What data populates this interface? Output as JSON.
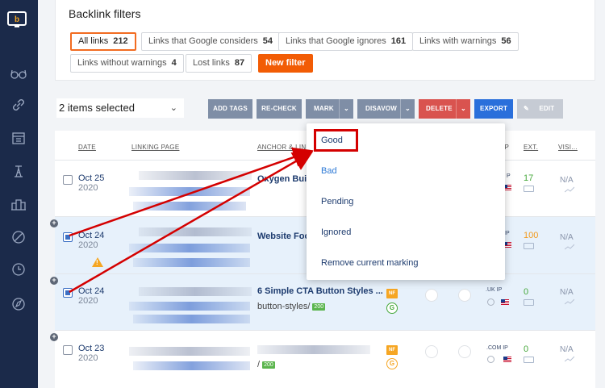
{
  "filters": {
    "title": "Backlink filters",
    "chips": [
      {
        "label": "All links",
        "count": "212"
      },
      {
        "label": "Links that Google considers",
        "count": "54"
      },
      {
        "label": "Links that Google ignores",
        "count": "161"
      },
      {
        "label": "Links with warnings",
        "count": "56"
      },
      {
        "label": "Links without warnings",
        "count": "4"
      },
      {
        "label": "Lost links",
        "count": "87"
      }
    ],
    "new_filter": "New filter"
  },
  "toolbar": {
    "selected_text": "2 items selected",
    "add_tags": "ADD TAGS",
    "recheck": "RE-CHECK",
    "mark": "MARK",
    "disavow": "DISAVOW",
    "delete": "DELETE",
    "export": "EXPORT",
    "edit": "EDIT"
  },
  "table": {
    "headers": {
      "date": "DATE",
      "linking_page": "LINKING PAGE",
      "anchor": "ANCHOR & LINK",
      "ip": "IP",
      "ext": "EXT.",
      "vis": "VISI..."
    },
    "rows": [
      {
        "md": "Oct 25",
        "year": "2020",
        "anchor": "Oxygen Buil",
        "url": "",
        "ext": "17",
        "vis": "N/A",
        "tld": "",
        "ip": "P"
      },
      {
        "md": "Oct 24",
        "year": "2020",
        "anchor": "Website Foo",
        "url": "",
        "ext": "100",
        "vis": "N/A",
        "tld": "",
        "ip": "IP"
      },
      {
        "md": "Oct 24",
        "year": "2020",
        "anchor": "6 Simple CTA Button Styles ...",
        "url": "button-styles/",
        "code": "200",
        "nf": "NF",
        "g": "G",
        "ext": "0",
        "vis": "N/A",
        "tld": ".UK",
        "ip": "IP"
      },
      {
        "md": "Oct 23",
        "year": "2020",
        "anchor": "",
        "url": "/",
        "code": "200",
        "nf": "NF",
        "g": "G",
        "ext": "0",
        "vis": "N/A",
        "tld": ".COM",
        "ip": "IP"
      }
    ]
  },
  "mark_menu": {
    "items": [
      "Good",
      "Bad",
      "Pending",
      "Ignored",
      "Remove current marking"
    ]
  },
  "colors": {
    "sidebar": "#1b2a4a",
    "accent_orange": "#f25c05",
    "btn_gray": "#7f8ea6",
    "delete_red": "#d9534f",
    "export_blue": "#2a6fdb",
    "annotation_red": "#d40000"
  },
  "icons": {
    "logo": "logo-icon",
    "sidebar": [
      "glasses-icon",
      "link-icon",
      "calendar-icon",
      "tower-icon",
      "buildings-icon",
      "ban-icon",
      "clock-icon",
      "compass-icon"
    ]
  }
}
